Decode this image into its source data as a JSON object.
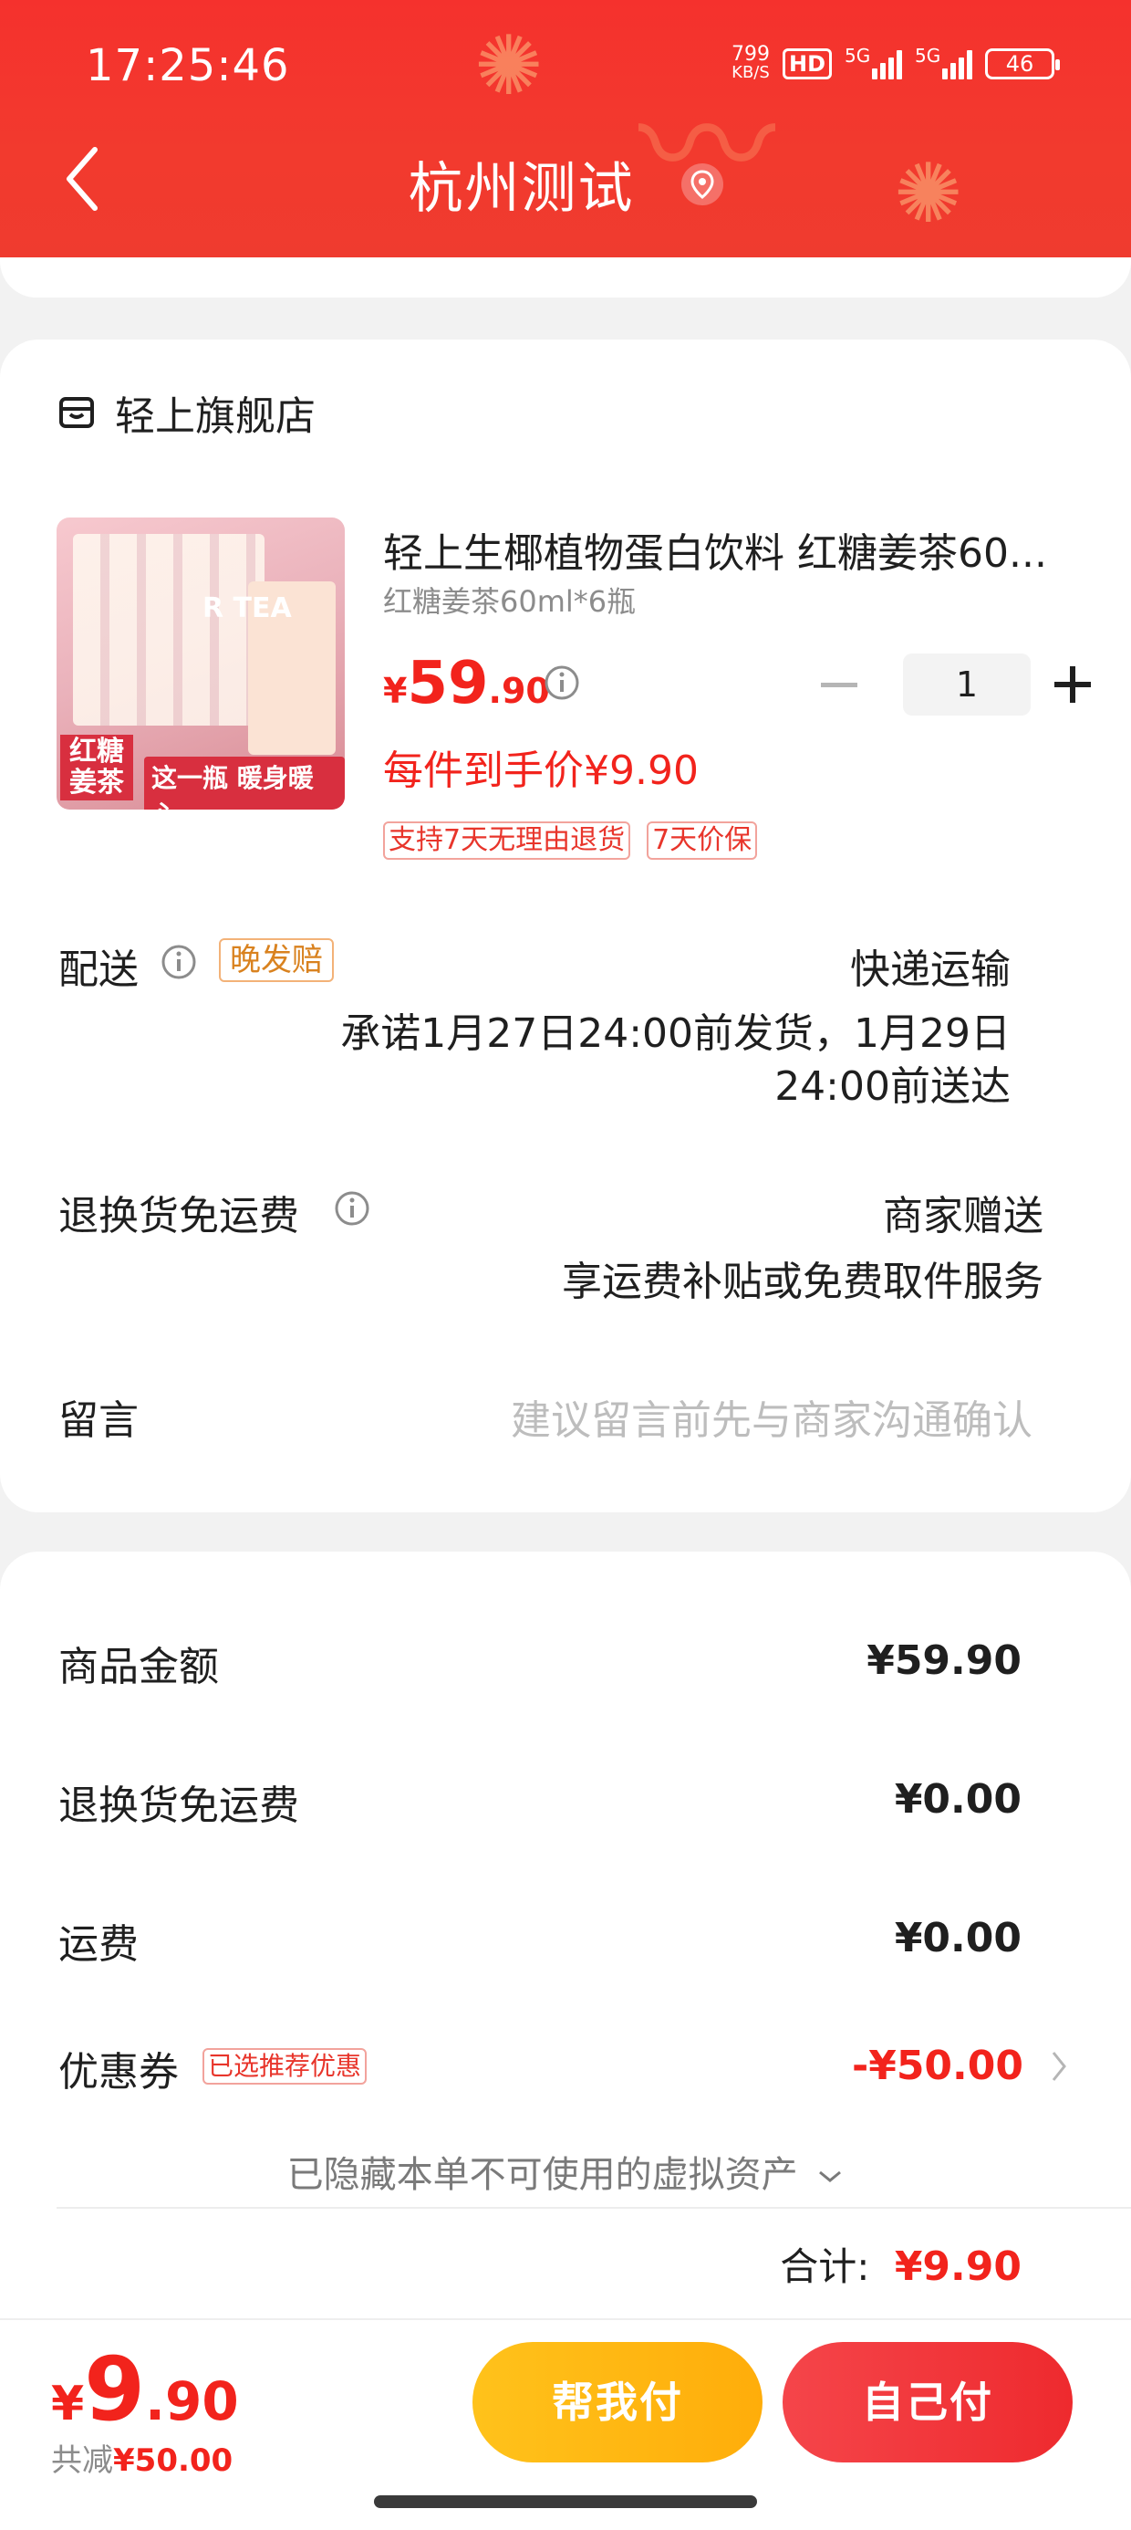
{
  "status_bar": {
    "time": "17:25:46",
    "net_speed": "799",
    "net_unit": "KB/S",
    "hd": "HD",
    "sig1": "5G",
    "sig2": "5G",
    "battery": "46"
  },
  "navbar": {
    "title": "杭州测试"
  },
  "store": {
    "name": "轻上旗舰店",
    "product": {
      "title": "轻上生椰植物蛋白饮料 红糖姜茶60...",
      "spec": "红糖姜茶60ml*6瓶",
      "currency": "¥",
      "price_int": "59",
      "price_dec": ".90",
      "quantity": "1",
      "unit_price": "每件到手价¥9.90",
      "tags": [
        "支持7天无理由退货",
        "7天价保"
      ],
      "image_text": {
        "left": "红糖\n姜茶",
        "slogan": "这一瓶 暖身暖心",
        "tea": "R TEA"
      }
    },
    "delivery": {
      "label": "配送",
      "badge": "晚发赔",
      "method": "快递运输",
      "promise_line1": "承诺1月27日24:00前发货，1月29日",
      "promise_line2": "24:00前送达"
    },
    "return_fee": {
      "label": "退换货免运费",
      "value": "商家赠送",
      "desc": "享运费补贴或免费取件服务"
    },
    "message": {
      "label": "留言",
      "placeholder": "建议留言前先与商家沟通确认"
    }
  },
  "summary": {
    "goods_label": "商品金额",
    "goods_value": "¥59.90",
    "return_label": "退换货免运费",
    "return_value": "¥0.00",
    "shipping_label": "运费",
    "shipping_value": "¥0.00",
    "coupon_label": "优惠券",
    "coupon_tag": "已选推荐优惠",
    "coupon_value": "-¥50.00",
    "hidden_assets": "已隐藏本单不可使用的虚拟资产",
    "total_label": "合计:",
    "total_value": "¥9.90"
  },
  "bottom_bar": {
    "currency": "¥",
    "price_int": "9",
    "price_dec": ".90",
    "saved_label": "共减",
    "saved_value": "¥50.00",
    "help_pay": "帮我付",
    "self_pay": "自己付"
  },
  "colors": {
    "accent": "#f2231c",
    "header": "#f23a2e",
    "help_btn": "#ffb512",
    "self_btn": "#f0353a"
  }
}
